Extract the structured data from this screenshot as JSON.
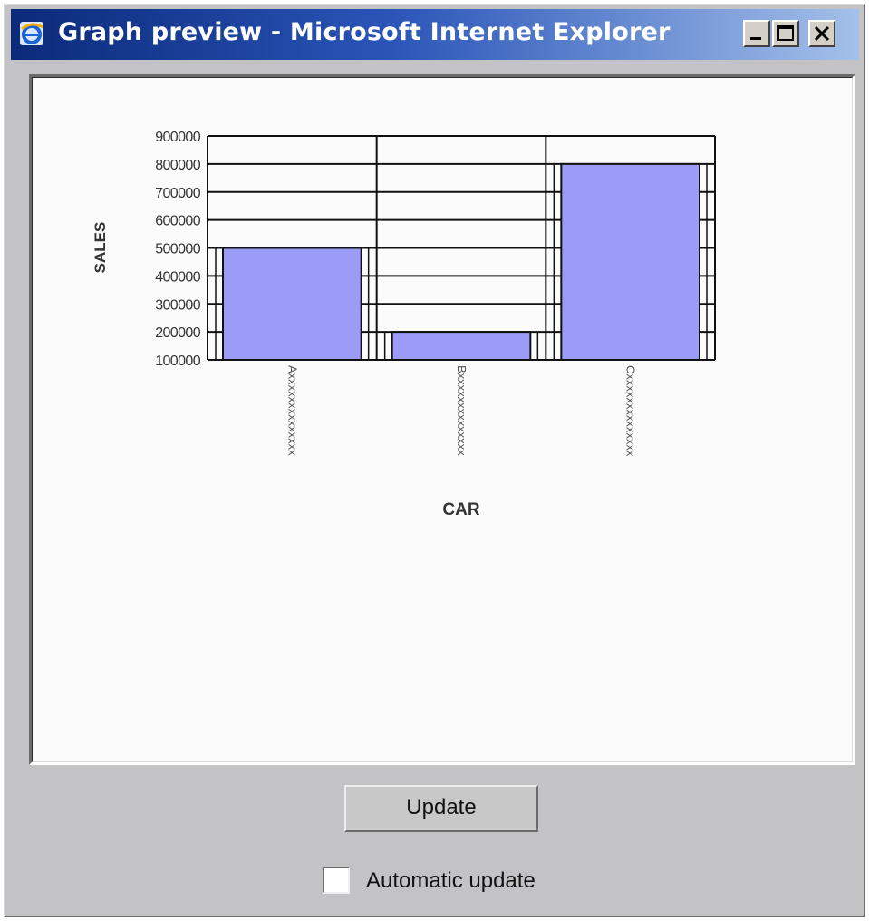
{
  "window": {
    "title": "Graph preview - Microsoft Internet Explorer",
    "controls": {
      "minimize": "_",
      "maximize": "□",
      "close": "×"
    }
  },
  "icons": [
    "ie-icon",
    "minimize-icon",
    "maximize-icon",
    "close-icon",
    "checkbox-icon"
  ],
  "colors": {
    "titlebar_start": "#0b2a7a",
    "titlebar_end": "#a4c0ea",
    "bar_fill": "#9b9bf8",
    "window_bg": "#c3c2c5",
    "plot_bg": "#fbfbfb"
  },
  "chart_data": {
    "type": "bar",
    "categories": [
      "Axxxxxxxxxxxxxx",
      "Bxxxxxxxxxxxxxx",
      "Cxxxxxxxxxxxxxx"
    ],
    "values": [
      500000,
      200000,
      800000
    ],
    "xlabel": "CAR",
    "ylabel": "SALES",
    "ylim": [
      100000,
      900000
    ],
    "yticks": [
      900000,
      800000,
      700000,
      600000,
      500000,
      400000,
      300000,
      200000,
      100000
    ],
    "ytick_labels": [
      "900000",
      "800000",
      "700000",
      "600000",
      "500000",
      "400000",
      "300000",
      "200000",
      "100000"
    ],
    "grid": true
  },
  "controls": {
    "update_label": "Update",
    "auto_update_label": "Automatic update",
    "auto_update_checked": false
  }
}
